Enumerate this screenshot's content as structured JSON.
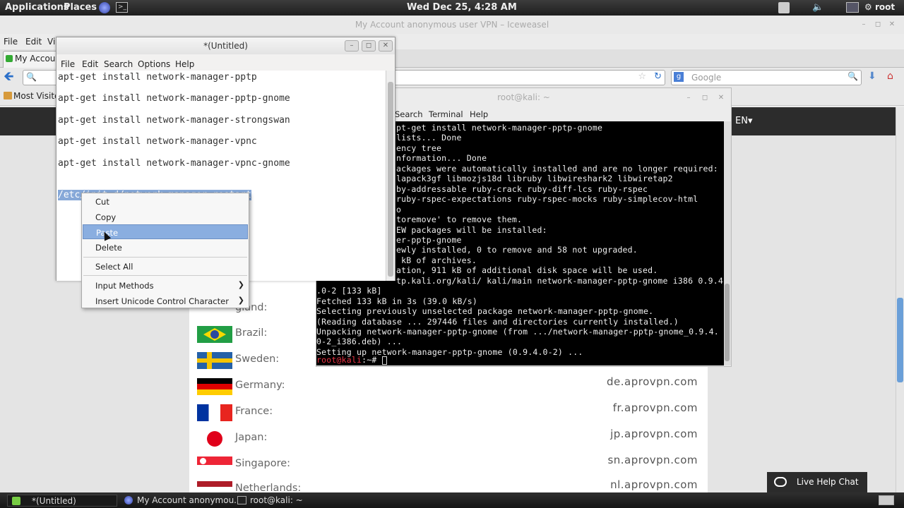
{
  "top_panel": {
    "applications": "Applications",
    "places": "Places",
    "clock": "Wed Dec 25,  4:28 AM",
    "user": "root"
  },
  "browser": {
    "title": "My Account anonymous user VPN – Iceweasel",
    "menu": [
      "File",
      "Edit",
      "Vi"
    ],
    "tab_label": "My Accoun",
    "search_placeholder": "Google",
    "bookmark_label": "Most Visite",
    "lang": "EN▾",
    "countries": [
      {
        "name": "gland:",
        "domain": ""
      },
      {
        "name": "Brazil:",
        "domain": ""
      },
      {
        "name": "Sweden:",
        "domain": ""
      },
      {
        "name": "Germany:",
        "domain": "de.aprovpn.com"
      },
      {
        "name": "France:",
        "domain": "fr.aprovpn.com"
      },
      {
        "name": "Japan:",
        "domain": "jp.aprovpn.com"
      },
      {
        "name": "Singapore:",
        "domain": "sn.aprovpn.com"
      },
      {
        "name": "Netherlands:",
        "domain": "nl.aprovpn.com"
      }
    ],
    "live_chat": "Live Help Chat"
  },
  "gedit": {
    "title": "*(Untitled)",
    "menu": [
      "File",
      "Edit",
      "Search",
      "Options",
      "Help"
    ],
    "lines": [
      "apt-get install network-manager-pptp",
      "apt-get install network-manager-pptp-gnome",
      "apt-get install network-manager-strongswan",
      "apt-get install network-manager-vpnc",
      "apt-get install network-manager-vpnc-gnome",
      "/etc/init.d/network-manager restart"
    ]
  },
  "context_menu": {
    "items": [
      "Cut",
      "Copy",
      "Paste",
      "Delete",
      "Select All",
      "Input Methods",
      "Insert Unicode Control Character"
    ]
  },
  "terminal": {
    "title": "root@kali: ~",
    "menu": [
      "Search",
      "Terminal",
      "Help"
    ],
    "lines": [
      "pt-get install network-manager-pptp-gnome",
      "lists... Done",
      "ency tree",
      "nformation... Done",
      "ackages were automatically installed and are no longer required:",
      "lapack3gf libmozjs18d libruby libwireshark2 libwiretap2",
      "by-addressable ruby-crack ruby-diff-lcs ruby-rspec",
      "ruby-rspec-expectations ruby-rspec-mocks ruby-simplecov-html",
      "o",
      "toremove' to remove them.",
      "EW packages will be installed:",
      "er-pptp-gnome",
      "ewly installed, 0 to remove and 58 not upgraded.",
      " kB of archives.",
      "ation, 911 kB of additional disk space will be used.",
      "tp.kali.org/kali/ kali/main network-manager-pptp-gnome i386 0.9.4",
      ".0-2 [133 kB]",
      "Fetched 133 kB in 3s (39.0 kB/s)",
      "Selecting previously unselected package network-manager-pptp-gnome.",
      "(Reading database ... 297446 files and directories currently installed.)",
      "Unpacking network-manager-pptp-gnome (from .../network-manager-pptp-gnome_0.9.4.",
      "0-2_i386.deb) ...",
      "Setting up network-manager-pptp-gnome (0.9.4.0-2) ..."
    ],
    "prompt_user": "root@kali",
    "prompt_rest": ":~# "
  },
  "taskbar": {
    "items": [
      "*(Untitled)",
      "My Account anonymou...",
      "root@kali: ~"
    ]
  }
}
